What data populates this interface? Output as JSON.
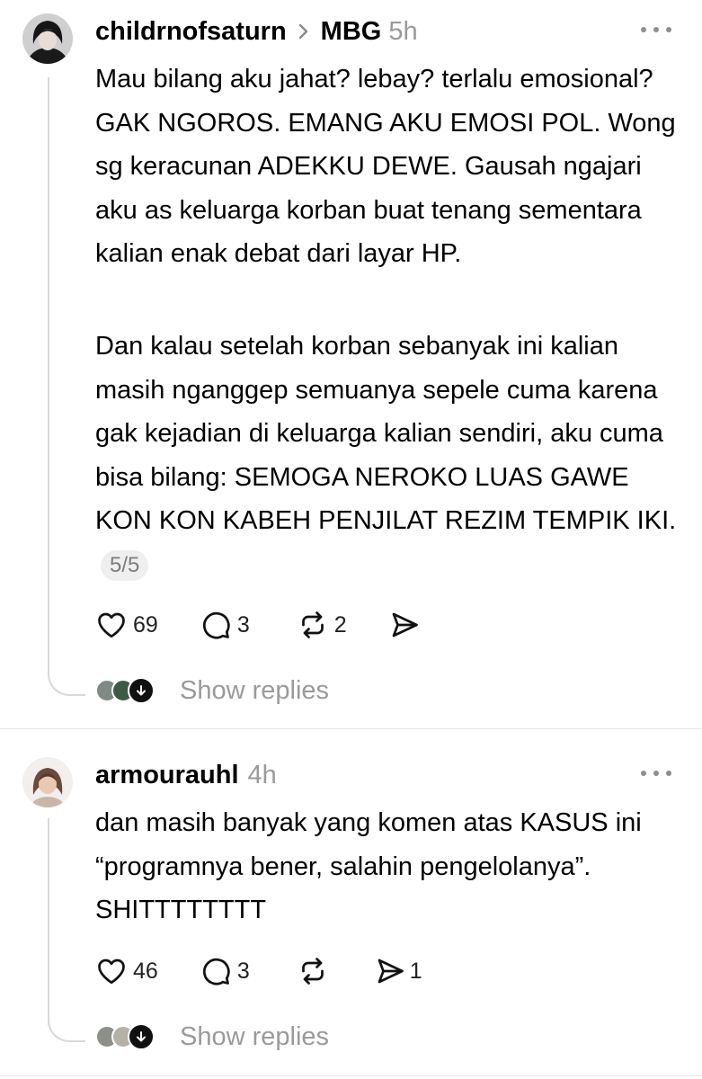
{
  "posts": [
    {
      "username": "childrnofsaturn",
      "community": "MBG",
      "time": "5h",
      "paragraphs": [
        "Mau bilang aku jahat? lebay? terlalu emosional? GAK NGOROS. EMANG AKU EMOSI POL. Wong sg keracunan ADEKKU DEWE. Gausah ngajari aku as keluarga korban buat tenang sementara kalian enak debat dari layar HP.",
        "Dan kalau setelah korban sebanyak ini kalian masih nganggep semuanya sepele cuma karena gak kejadian di keluarga kalian sendiri, aku cuma bisa bilang: SEMOGA NEROKO LUAS GAWE KON KON KABEH PENJILAT REZIM TEMPIK IKI."
      ],
      "page_indicator": "5/5",
      "likes": "69",
      "comments": "3",
      "reposts": "2",
      "shares": "",
      "show_replies": "Show replies"
    },
    {
      "username": "armourauhl",
      "time": "4h",
      "paragraphs": [
        "dan masih banyak yang komen atas KASUS ini “programnya bener, salahin pengelolanya”. SHITTTTTTTT"
      ],
      "likes": "46",
      "comments": "3",
      "reposts": "",
      "shares": "1",
      "show_replies": "Show replies"
    }
  ],
  "icons": {
    "like": "heart-icon",
    "comment": "comment-bubble-icon",
    "repost": "repost-icon",
    "share": "send-icon",
    "more": "more-dots-icon",
    "chevron": "chevron-right-icon",
    "replies": "arrow-down-icon"
  },
  "colors": {
    "text": "#000000",
    "muted": "#9a9a9a",
    "line": "#d9d9d9"
  }
}
